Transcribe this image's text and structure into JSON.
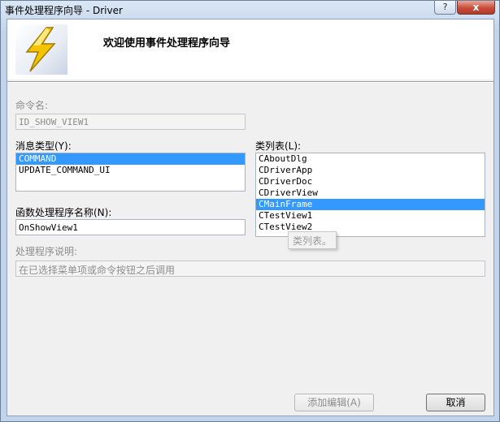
{
  "window": {
    "title": "事件处理程序向导 - Driver",
    "help_glyph": "?",
    "close_glyph": "x"
  },
  "header": {
    "title": "欢迎使用事件处理程序向导",
    "icon": "lightning-bolt-icon"
  },
  "command_name": {
    "label": "命令名:",
    "value": "ID_SHOW_VIEW1"
  },
  "message_type": {
    "label": "消息类型(Y):",
    "items": [
      "COMMAND",
      "UPDATE_COMMAND_UI"
    ],
    "selected_index": 0
  },
  "class_list": {
    "label": "类列表(L):",
    "items": [
      "CAboutDlg",
      "CDriverApp",
      "CDriverDoc",
      "CDriverView",
      "CMainFrame",
      "CTestView1",
      "CTestView2"
    ],
    "selected_index": 4,
    "tooltip": "类列表。"
  },
  "handler_name": {
    "label": "函数处理程序名称(N):",
    "value": "OnShowView1"
  },
  "description": {
    "label": "处理程序说明:",
    "value": "在已选择菜单项或命令按钮之后调用"
  },
  "buttons": {
    "add_edit": "添加编辑(A)",
    "cancel": "取消"
  },
  "colors": {
    "selection": "#3399ff",
    "disabled_text": "#8d8d8d",
    "close_button": "#c74d3a"
  }
}
